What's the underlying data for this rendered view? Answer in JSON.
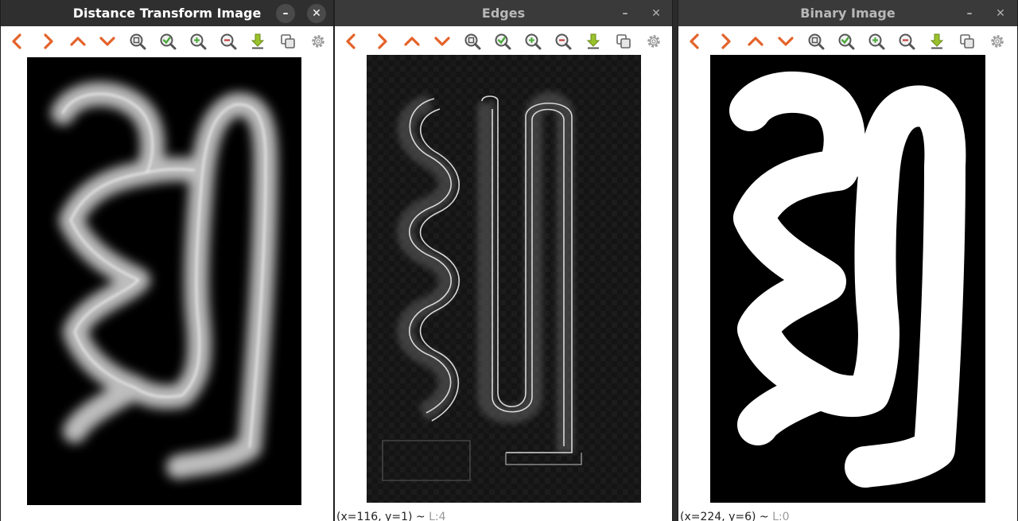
{
  "windows": [
    {
      "title": "Distance Transform Image",
      "active": true,
      "minimize_glyph": "–",
      "close_glyph": "✕",
      "status_coords": "",
      "status_level": ""
    },
    {
      "title": "Edges",
      "active": false,
      "minimize_glyph": "–",
      "close_glyph": "✕",
      "status_coords": "(x=116, y=1) ~ ",
      "status_level": "L:4"
    },
    {
      "title": "Binary Image",
      "active": false,
      "minimize_glyph": "–",
      "close_glyph": "✕",
      "status_coords": "(x=224, y=6) ~ ",
      "status_level": "L:0"
    }
  ],
  "toolbar_icons": [
    "chevron-left-icon",
    "chevron-right-icon",
    "chevron-up-icon",
    "chevron-down-icon",
    "zoom-fit-icon",
    "zoom-reset-icon",
    "zoom-in-icon",
    "zoom-out-icon",
    "save-icon",
    "copy-icon",
    "settings-icon"
  ],
  "colors": {
    "arrow_orange": "#e4622a",
    "ok_green": "#4aa83a",
    "save_yellow_green": "#9ac22a",
    "titlebar_active": "#2f2f2f",
    "titlebar_inactive": "#3a3a3a"
  }
}
